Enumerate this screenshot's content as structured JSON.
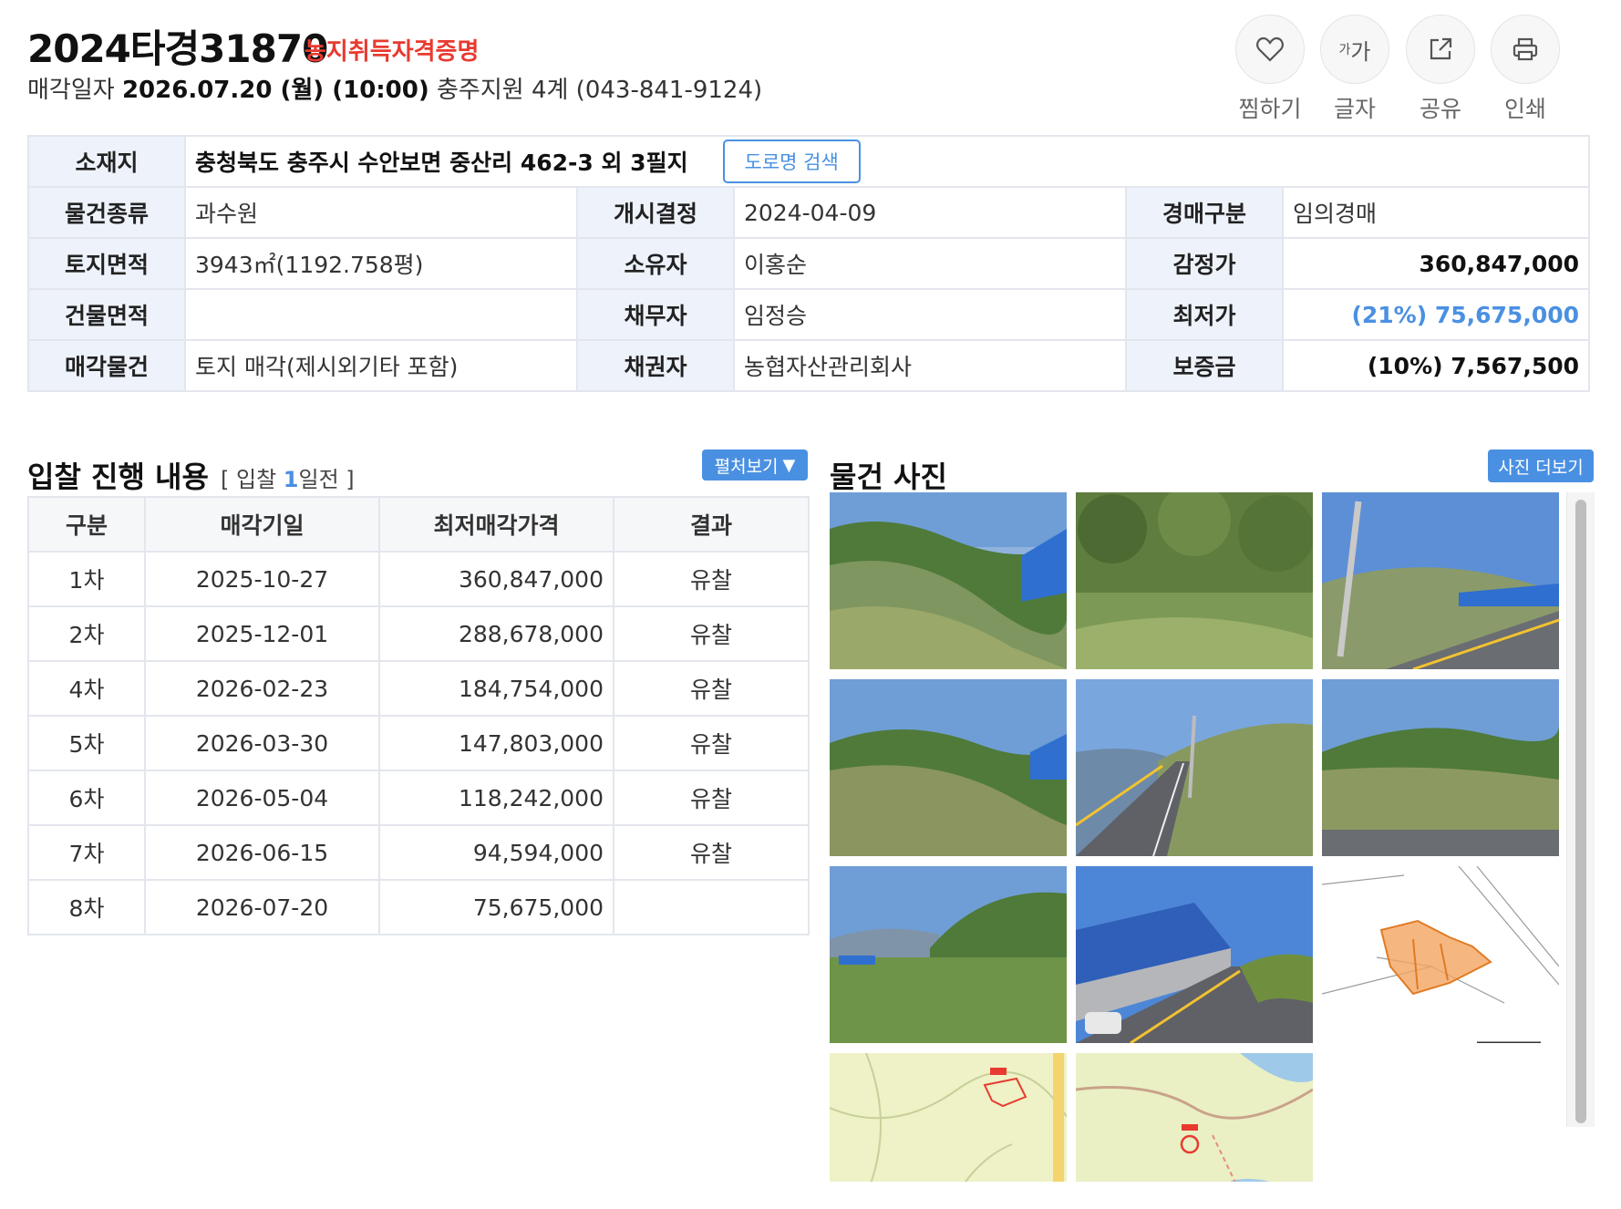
{
  "header": {
    "case_number": "2024타경31870",
    "tag": "농지취득자격증명",
    "sale_prefix": "매각일자",
    "sale_date": "2026.07.20 (월) (10:00)",
    "court": "충주지원 4계 (043-841-9124)"
  },
  "actions": [
    {
      "label": "찜하기",
      "icon": "heart-icon"
    },
    {
      "label": "글자",
      "icon": "font-size-icon",
      "glyph": "가가"
    },
    {
      "label": "공유",
      "icon": "share-icon"
    },
    {
      "label": "인쇄",
      "icon": "print-icon"
    }
  ],
  "info": {
    "address_label": "소재지",
    "address": "충청북도 충주시 수안보면 중산리 462-3 외 3필지",
    "road_search": "도로명 검색",
    "rows": [
      [
        "물건종류",
        "과수원",
        "개시결정",
        "2024-04-09",
        "경매구분",
        "임의경매"
      ],
      [
        "토지면적",
        "3943㎡(1192.758평)",
        "소유자",
        "이홍순",
        "감정가",
        "360,847,000"
      ],
      [
        "건물면적",
        "",
        "채무자",
        "임정승",
        "최저가",
        "(21%) 75,675,000"
      ],
      [
        "매각물건",
        "토지 매각(제시외기타 포함)",
        "채권자",
        "농협자산관리회사",
        "보증금",
        "(10%) 7,567,500"
      ]
    ]
  },
  "bids": {
    "title": "입찰 진행 내용",
    "sub_prefix": "[ 입찰",
    "sub_count": "1",
    "sub_suffix": "일전 ]",
    "expand": "펼처보기",
    "headers": [
      "구분",
      "매각기일",
      "최저매각가격",
      "결과"
    ],
    "rows": [
      [
        "1차",
        "2025-10-27",
        "360,847,000",
        "유찰"
      ],
      [
        "2차",
        "2025-12-01",
        "288,678,000",
        "유찰"
      ],
      [
        "4차",
        "2026-02-23",
        "184,754,000",
        "유찰"
      ],
      [
        "5차",
        "2026-03-30",
        "147,803,000",
        "유찰"
      ],
      [
        "6차",
        "2026-05-04",
        "118,242,000",
        "유찰"
      ],
      [
        "7차",
        "2026-06-15",
        "94,594,000",
        "유찰"
      ],
      [
        "8차",
        "2026-07-20",
        "75,675,000",
        ""
      ]
    ]
  },
  "photos": {
    "title": "물건 사진",
    "more": "사진 더보기",
    "items": [
      "hillside-photo",
      "forest-photo",
      "roadside-pole-photo",
      "hillside-photo",
      "road-photo",
      "hillside-photo",
      "valley-photo",
      "warehouse-road-photo",
      "cadastral-map",
      "land-map",
      "area-map"
    ]
  },
  "colors": {
    "accent": "#4a90e2",
    "tag_red": "#e83a30",
    "header_bg": "#eef3fb"
  }
}
